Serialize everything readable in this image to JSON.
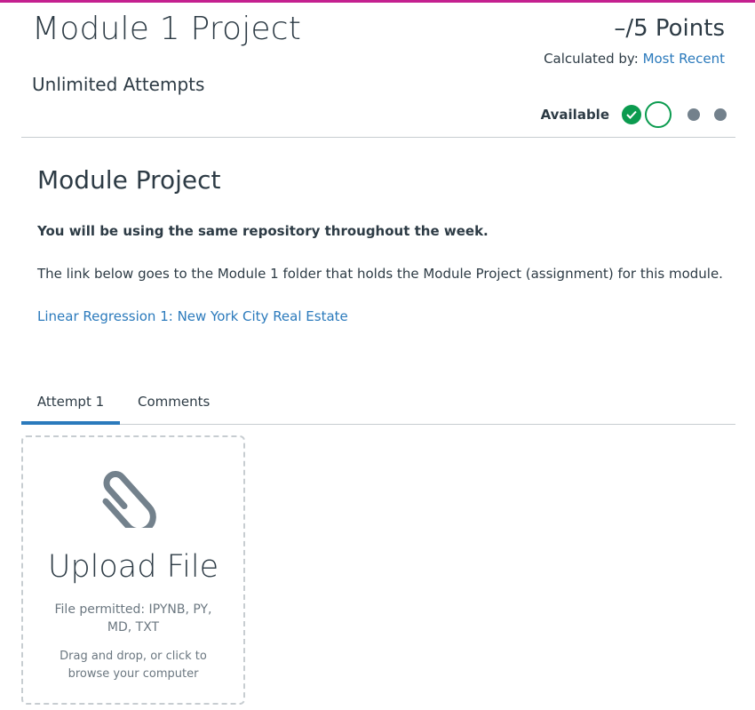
{
  "colors": {
    "accent_bar": "#c4208f",
    "link": "#2b7abc",
    "success": "#0b9b4f",
    "muted_dot": "#73818c",
    "text": "#2d3b45",
    "border": "#c7cdd1"
  },
  "header": {
    "title": "Module 1 Project",
    "points": "–/5 Points",
    "calculated_by_label": "Calculated by:",
    "calculated_by_value": "Most Recent",
    "attempts": "Unlimited Attempts",
    "status_label": "Available",
    "steps": [
      {
        "state": "completed",
        "icon": "check-icon"
      },
      {
        "state": "current",
        "icon": "empty-circle-icon"
      },
      {
        "state": "upcoming",
        "icon": "dot-icon"
      },
      {
        "state": "upcoming",
        "icon": "dot-icon"
      }
    ]
  },
  "content": {
    "heading": "Module Project",
    "bold_note": "You will be using the same repository throughout the week.",
    "description": "The link below goes to the Module 1 folder that holds the Module Project (assignment) for this module.",
    "link_text": "Linear Regression 1: New York City Real Estate"
  },
  "tabs": [
    {
      "label": "Attempt 1",
      "selected": true
    },
    {
      "label": "Comments",
      "selected": false
    }
  ],
  "upload": {
    "icon": "paperclip-icon",
    "title": "Upload File",
    "permitted": "File permitted: IPYNB, PY, MD, TXT",
    "instructions": "Drag and drop, or click to browse your computer"
  }
}
